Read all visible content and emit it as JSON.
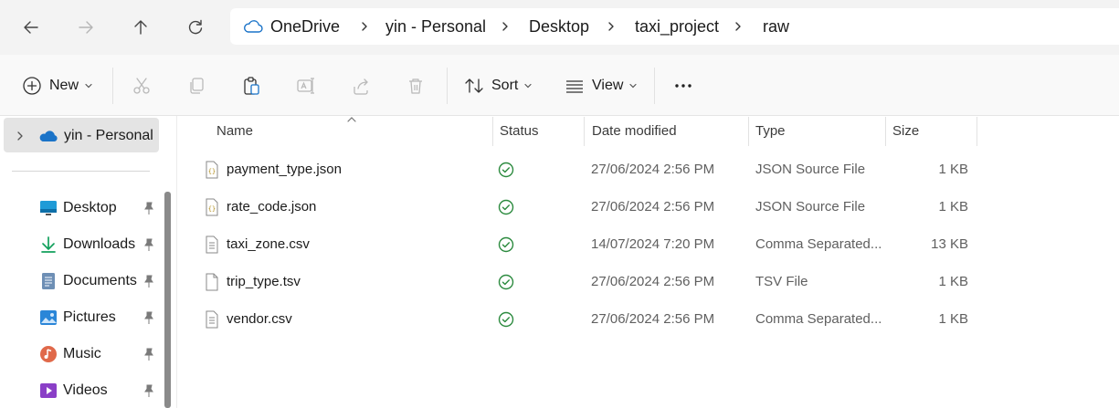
{
  "address": {
    "breadcrumbs": [
      "OneDrive",
      "yin - Personal",
      "Desktop",
      "taxi_project",
      "raw"
    ]
  },
  "toolbar": {
    "new_label": "New",
    "sort_label": "Sort",
    "view_label": "View"
  },
  "sidebar": {
    "root_label": "yin - Personal",
    "items": [
      {
        "label": "Desktop",
        "icon": "desktop-icon"
      },
      {
        "label": "Downloads",
        "icon": "download-icon"
      },
      {
        "label": "Documents",
        "icon": "documents-icon"
      },
      {
        "label": "Pictures",
        "icon": "pictures-icon"
      },
      {
        "label": "Music",
        "icon": "music-icon"
      },
      {
        "label": "Videos",
        "icon": "videos-icon"
      }
    ]
  },
  "columns": {
    "name": "Name",
    "status": "Status",
    "date": "Date modified",
    "type": "Type",
    "size": "Size"
  },
  "files": [
    {
      "name": "payment_type.json",
      "date": "27/06/2024 2:56 PM",
      "type": "JSON Source File",
      "size": "1 KB",
      "icon": "json-file-icon"
    },
    {
      "name": "rate_code.json",
      "date": "27/06/2024 2:56 PM",
      "type": "JSON Source File",
      "size": "1 KB",
      "icon": "json-file-icon"
    },
    {
      "name": "taxi_zone.csv",
      "date": "14/07/2024 7:20 PM",
      "type": "Comma Separated...",
      "size": "13 KB",
      "icon": "csv-file-icon"
    },
    {
      "name": "trip_type.tsv",
      "date": "27/06/2024 2:56 PM",
      "type": "TSV File",
      "size": "1 KB",
      "icon": "blank-file-icon"
    },
    {
      "name": "vendor.csv",
      "date": "27/06/2024 2:56 PM",
      "type": "Comma Separated...",
      "size": "1 KB",
      "icon": "csv-file-icon"
    }
  ],
  "colors": {
    "accent": "#0067c0",
    "sync_green": "#2b8a3e",
    "selection": "#e4e4e4"
  }
}
